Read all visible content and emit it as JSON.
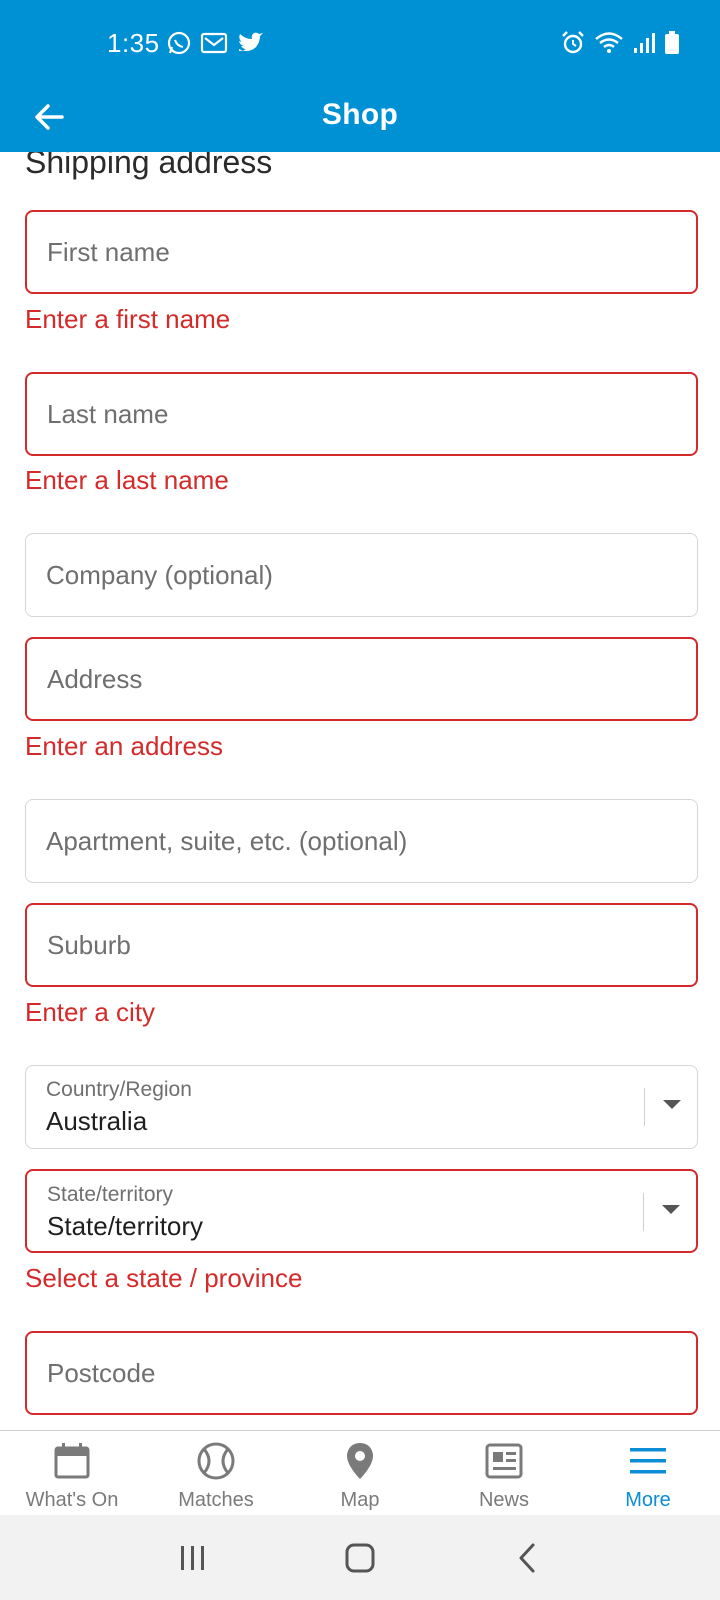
{
  "status_bar": {
    "time": "1:35",
    "notification_icons": [
      "whatsapp-icon",
      "gmail-icon",
      "twitter-icon"
    ],
    "system_icons": [
      "alarm-icon",
      "wifi-icon",
      "signal-icon",
      "battery-icon"
    ]
  },
  "app_bar": {
    "title": "Shop",
    "back_icon": "arrow-left-icon",
    "background": "#0090d4"
  },
  "form": {
    "section_title": "Shipping address",
    "fields": {
      "first_name": {
        "placeholder": "First name",
        "error": "Enter a first name"
      },
      "last_name": {
        "placeholder": "Last name",
        "error": "Enter a last name"
      },
      "company": {
        "placeholder": "Company (optional)"
      },
      "address": {
        "placeholder": "Address",
        "error": "Enter an address"
      },
      "apartment": {
        "placeholder": "Apartment, suite, etc. (optional)"
      },
      "suburb": {
        "placeholder": "Suburb",
        "error": "Enter a city"
      },
      "country": {
        "label": "Country/Region",
        "value": "Australia"
      },
      "state": {
        "label": "State/territory",
        "value": "State/territory",
        "error": "Select a state / province"
      },
      "postcode": {
        "placeholder": "Postcode"
      }
    },
    "error_color": "#d52a2a"
  },
  "bottom_nav": {
    "items": [
      {
        "label": "What's On",
        "icon": "calendar-icon",
        "active": false
      },
      {
        "label": "Matches",
        "icon": "ball-icon",
        "active": false
      },
      {
        "label": "Map",
        "icon": "map-pin-icon",
        "active": false
      },
      {
        "label": "News",
        "icon": "newspaper-icon",
        "active": false
      },
      {
        "label": "More",
        "icon": "menu-icon",
        "active": true
      }
    ],
    "active_color": "#0b8ed6"
  },
  "system_nav": {
    "buttons": [
      "recents-icon",
      "home-icon",
      "back-icon"
    ]
  }
}
